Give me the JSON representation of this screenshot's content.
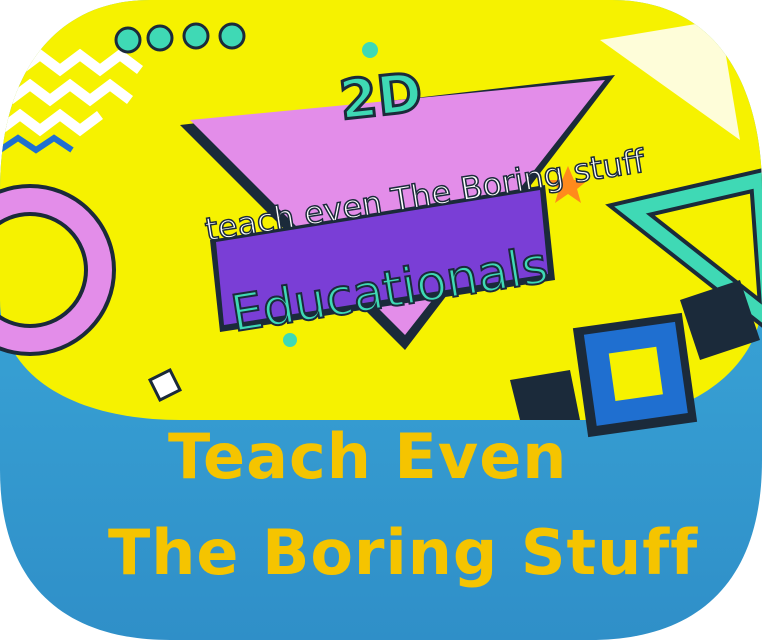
{
  "artwork": {
    "badge_text": "2D",
    "tagline": "teach even The Boring stuff",
    "banner_text": "Educationals"
  },
  "caption": {
    "line1": "Teach Even",
    "line2": "The Boring Stuff"
  },
  "colors": {
    "yellow_bg": "#f6f200",
    "blue_bg": "#3aa7d6",
    "caption_text": "#f5c400",
    "pink": "#e38de9",
    "purple": "#7a3ed6",
    "teal": "#3fd9b5",
    "dark_blue": "#1f6fd0"
  }
}
